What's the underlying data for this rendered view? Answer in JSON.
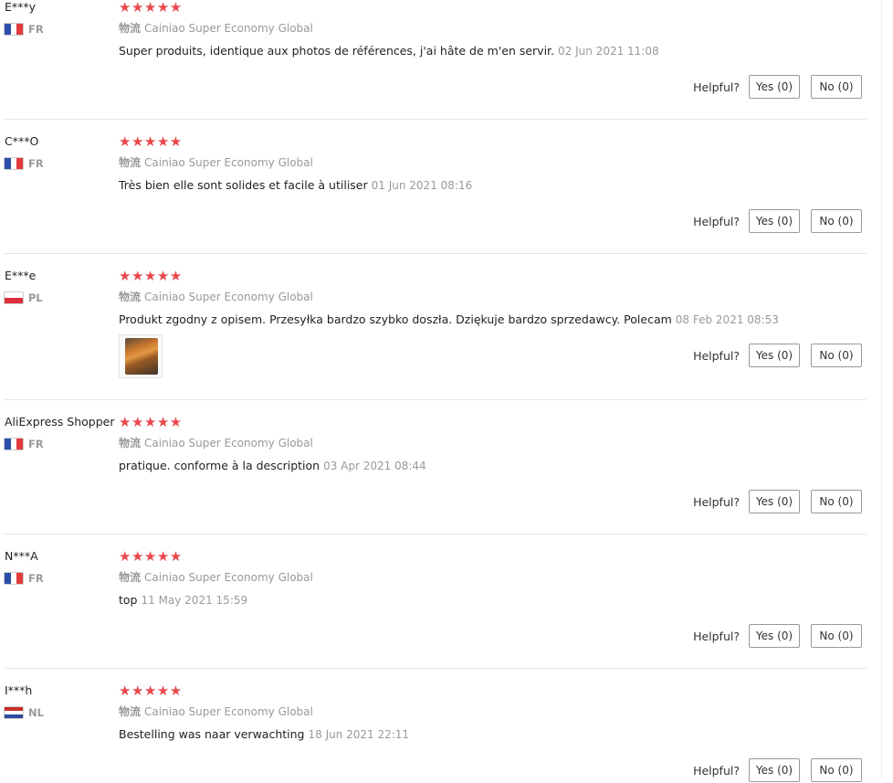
{
  "helpful_label": "Helpful?",
  "logistics_label": "物流",
  "reviews": [
    {
      "user": "E***y",
      "country": "FR",
      "stars": "★★★★★",
      "logistics": "Cainiao Super Economy Global",
      "text": "Super produits, identique aux photos de références, j'ai hâte de m'en servir.",
      "date": "02 Jun 2021 11:08",
      "yes": "Yes (0)",
      "no": "No (0)"
    },
    {
      "user": "C***O",
      "country": "FR",
      "stars": "★★★★★",
      "logistics": "Cainiao Super Economy Global",
      "text": "Très bien elle sont solides et facile à utiliser",
      "date": "01 Jun 2021 08:16",
      "yes": "Yes (0)",
      "no": "No (0)"
    },
    {
      "user": "E***e",
      "country": "PL",
      "stars": "★★★★★",
      "logistics": "Cainiao Super Economy Global",
      "text": "Produkt zgodny z opisem. Przesyłka bardzo szybko doszła. Dziękuje bardzo sprzedawcy. Polecam",
      "date": "08 Feb 2021 08:53",
      "yes": "Yes (0)",
      "no": "No (0)"
    },
    {
      "user": "AliExpress Shopper",
      "country": "FR",
      "stars": "★★★★★",
      "logistics": "Cainiao Super Economy Global",
      "text": "pratique. conforme à la description",
      "date": "03 Apr 2021 08:44",
      "yes": "Yes (0)",
      "no": "No (0)"
    },
    {
      "user": "N***A",
      "country": "FR",
      "stars": "★★★★★",
      "logistics": "Cainiao Super Economy Global",
      "text": "top",
      "date": "11 May 2021 15:59",
      "yes": "Yes (0)",
      "no": "No (0)"
    },
    {
      "user": "I***h",
      "country": "NL",
      "stars": "★★★★★",
      "logistics": "Cainiao Super Economy Global",
      "text": "Bestelling was naar verwachting",
      "date": "18 Jun 2021 22:11",
      "yes": "Yes (0)",
      "no": "No (0)"
    }
  ],
  "colors": {
    "star": "#e8484c",
    "muted": "#999999",
    "divider": "#e6e6e6"
  }
}
